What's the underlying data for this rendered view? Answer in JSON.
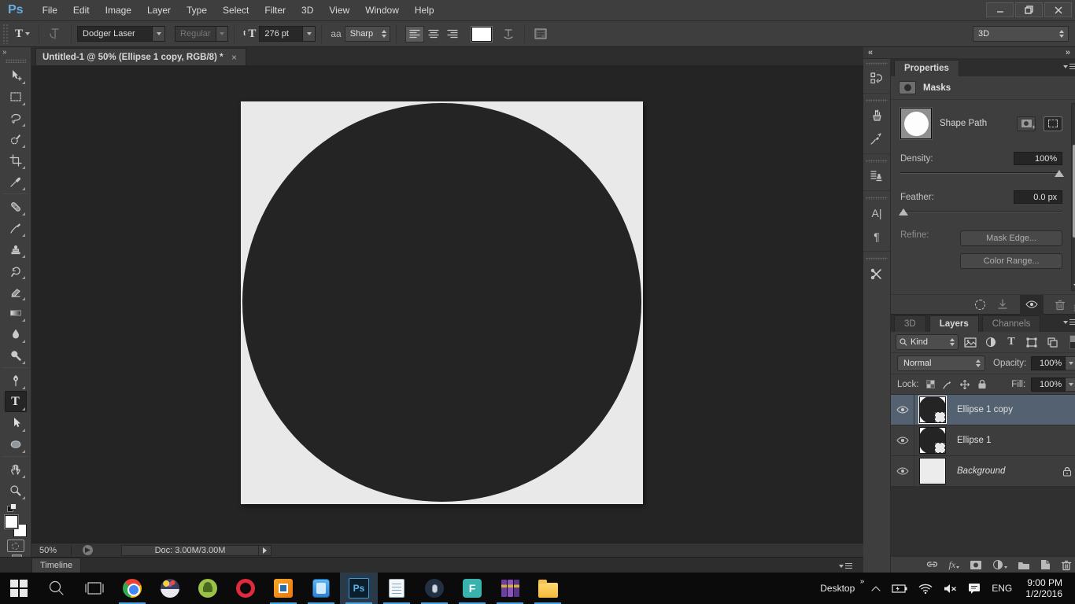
{
  "window": {
    "logo": "Ps",
    "controls": {
      "minimize": "minimize",
      "restore": "restore",
      "close": "close"
    }
  },
  "menu_bar": {
    "items": [
      "File",
      "Edit",
      "Image",
      "Layer",
      "Type",
      "Select",
      "Filter",
      "3D",
      "View",
      "Window",
      "Help"
    ]
  },
  "options_bar": {
    "font_family": "Dodger Laser",
    "font_style": "Regular",
    "font_size": "276 pt",
    "anti_aliasing": "Sharp",
    "workspace": "3D",
    "glyphs": {
      "type_tool": "T",
      "size_small": "t",
      "size_big": "T",
      "aa": "aa"
    }
  },
  "document_tab": {
    "title": "Untitled-1 @ 50% (Ellipse 1 copy, RGB/8) *",
    "close_glyph": "×"
  },
  "toolbar": {
    "collapse_glyph": "»",
    "selected_tool": "horizontal-type",
    "tools": [
      "move",
      "rectangular-marquee",
      "lasso",
      "quick-selection",
      "crop",
      "eyedropper",
      "spot-healing-brush",
      "brush",
      "clone-stamp",
      "history-brush",
      "eraser",
      "gradient",
      "blur",
      "dodge",
      "pen",
      "horizontal-type",
      "path-selection",
      "ellipse-shape",
      "hand",
      "zoom"
    ],
    "type_glyph": "T"
  },
  "canvas": {
    "page_color": "#e9e9e9",
    "circle_color": "#242424",
    "zoom": "50%"
  },
  "status_bar": {
    "zoom_level": "50%",
    "doc_info": "Doc: 3.00M/3.00M"
  },
  "timeline": {
    "tab": "Timeline"
  },
  "right_dock": {
    "collapse_left_glyph": "«",
    "collapse_right_glyph": "»",
    "icons": [
      "history",
      "tool-presets",
      "brush-presets",
      "clone-source",
      "character",
      "paragraph",
      "measurement"
    ],
    "character_glyph": "A|",
    "paragraph_glyph": "¶"
  },
  "properties_panel": {
    "tab": "Properties",
    "header": "Masks",
    "thumb_label": "Shape Path",
    "density_label": "Density:",
    "density_value": "100%",
    "feather_label": "Feather:",
    "feather_value": "0.0 px",
    "refine_label": "Refine:",
    "mask_edge_button": "Mask Edge...",
    "color_range_button": "Color Range..."
  },
  "layers_panel": {
    "tabs": [
      "3D",
      "Layers",
      "Channels"
    ],
    "active_tab": "Layers",
    "filter_label": "Kind",
    "blend_mode": "Normal",
    "opacity_label": "Opacity:",
    "opacity_value": "100%",
    "lock_label": "Lock:",
    "fill_label": "Fill:",
    "fill_value": "100%",
    "fx_label": "fx",
    "layers": [
      {
        "name": "Ellipse 1 copy",
        "selected": true,
        "kind": "shape"
      },
      {
        "name": "Ellipse 1",
        "selected": false,
        "kind": "shape"
      },
      {
        "name": "Background",
        "selected": false,
        "kind": "background",
        "locked": true
      }
    ]
  },
  "taskbar": {
    "apps": [
      "start",
      "search",
      "task-view",
      "chrome",
      "game-app",
      "android-studio",
      "opera",
      "vmware",
      "airdroid",
      "photoshop",
      "notepad",
      "voice-app",
      "f-app",
      "winrar",
      "file-explorer"
    ],
    "running_apps": [
      "chrome",
      "vmware",
      "airdroid",
      "photoshop",
      "notepad",
      "voice-app",
      "f-app",
      "winrar",
      "file-explorer"
    ],
    "active_app": "photoshop",
    "ps_glyph": "Ps",
    "opera_glyph": "O",
    "f_glyph": "F",
    "tray": {
      "desktop_label": "Desktop",
      "overflow_glyph": "»",
      "language": "ENG",
      "time": "9:00 PM",
      "date": "1/2/2016"
    }
  },
  "colors": {
    "accent_blue": "#4aa3df",
    "selected_layer": "#536170",
    "ps_logo_blue": "#64aee0",
    "panel_bg": "#3e3e3e",
    "canvas_bg": "#242424"
  }
}
